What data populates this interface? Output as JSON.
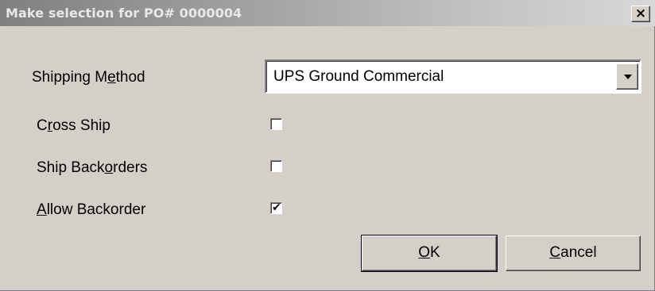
{
  "window": {
    "title": "Make selection for PO# 0000004",
    "close_label": "×"
  },
  "form": {
    "shipping_method": {
      "label_pre": "Shipping M",
      "label_accel": "e",
      "label_post": "thod",
      "selected": "UPS Ground Commercial"
    },
    "cross_ship": {
      "label_pre": "C",
      "label_accel": "r",
      "label_post": "oss Ship",
      "checked": false
    },
    "ship_backorders": {
      "label_pre": "Ship Back",
      "label_accel": "o",
      "label_post": "rders",
      "checked": false
    },
    "allow_backorder": {
      "label_pre": "",
      "label_accel": "A",
      "label_post": "llow Backorder",
      "checked": true
    }
  },
  "buttons": {
    "ok": {
      "accel": "O",
      "rest": "K"
    },
    "cancel": {
      "accel": "C",
      "rest": "ancel"
    }
  },
  "icons": {
    "checkmark": "✔",
    "dropdown": "chevron-down-icon"
  }
}
